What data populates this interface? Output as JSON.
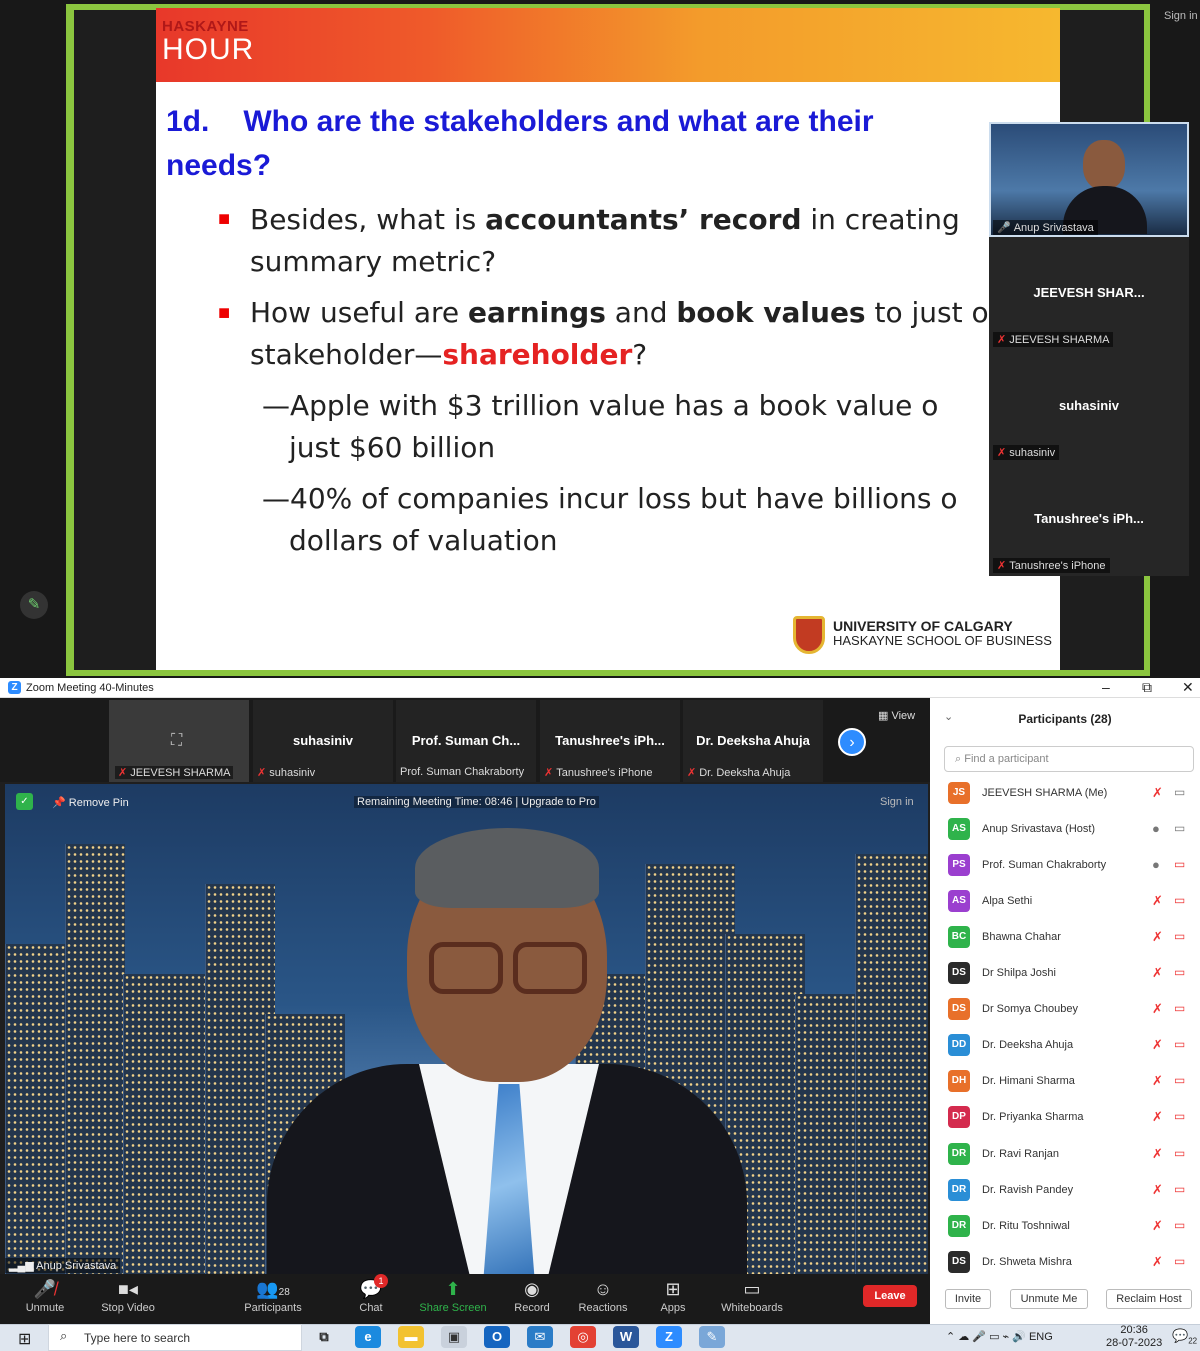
{
  "slide": {
    "brand": "HASKAYNE",
    "brand_sub": "HOUR",
    "title_num": "1d.",
    "title": "Who are the stakeholders and what are their needs?",
    "b1_pre": "Besides, what is ",
    "b1_bold": "accountants’ record",
    "b1_post": " in creating",
    "b1_line2": "summary metric?",
    "b2_pre": "How useful are ",
    "b2_bold1": "earnings",
    "b2_mid": " and ",
    "b2_bold2": "book values",
    "b2_post": " to just on",
    "b2_line2a": "stakeholder—",
    "b2_red": "shareholder",
    "b2_line2b": "?",
    "sub1_l1": "—Apple with $3 trillion value has a book value o",
    "sub1_l2": "just $60 billion",
    "sub2_l1": "—40% of companies incur loss but have billions o",
    "sub2_l2": "dollars of valuation",
    "logo_line1": "UNIVERSITY OF CALGARY",
    "logo_line2": "HASKAYNE SCHOOL OF BUSINESS"
  },
  "top_videos": [
    {
      "label": "Anup Srivastava"
    },
    {
      "name": "JEEVESH SHAR...",
      "label": "JEEVESH SHARMA"
    },
    {
      "name": "suhasiniv",
      "label": "suhasiniv"
    },
    {
      "name": "Tanushree's iPh...",
      "label": "Tanushree's iPhone"
    }
  ],
  "top_signin": "Sign in",
  "window": {
    "title": "Zoom Meeting 40-Minutes",
    "minimize": "–",
    "restore": "⧉",
    "close": "✕"
  },
  "thumbnails": [
    {
      "name": "",
      "label": "JEEVESH SHARMA"
    },
    {
      "name": "suhasiniv",
      "label": "suhasiniv"
    },
    {
      "name": "Prof. Suman Ch...",
      "label": "Prof. Suman Chakraborty"
    },
    {
      "name": "Tanushree's iPh...",
      "label": "Tanushree's iPhone"
    },
    {
      "name": "Dr. Deeksha Ahuja",
      "label": "Dr. Deeksha Ahuja"
    }
  ],
  "view_label": "View",
  "main_video": {
    "remove_pin": "Remove Pin",
    "remaining": "Remaining Meeting Time: 08:46 | Upgrade to Pro",
    "signin": "Sign in",
    "speaker": "Anup Srivastava"
  },
  "toolbar": {
    "unmute": "Unmute",
    "stop_video": "Stop Video",
    "participants": "Participants",
    "participants_count": "28",
    "chat": "Chat",
    "chat_badge": "1",
    "share_screen": "Share Screen",
    "record": "Record",
    "reactions": "Reactions",
    "apps": "Apps",
    "whiteboards": "Whiteboards",
    "leave": "Leave"
  },
  "participants_panel": {
    "title": "Participants (28)",
    "search_placeholder": "Find a participant",
    "invite": "Invite",
    "unmute_me": "Unmute Me",
    "reclaim_host": "Reclaim Host",
    "list": [
      {
        "initials": "JS",
        "name": "JEEVESH SHARMA (Me)",
        "color": "#e8702a"
      },
      {
        "initials": "AS",
        "name": "Anup Srivastava (Host)",
        "color": "#2fb34b"
      },
      {
        "initials": "PS",
        "name": "Prof. Suman Chakraborty",
        "color": "#9b3fcf"
      },
      {
        "initials": "AS",
        "name": "Alpa Sethi",
        "color": "#9b3fcf"
      },
      {
        "initials": "BC",
        "name": "Bhawna Chahar",
        "color": "#2fb34b"
      },
      {
        "initials": "DS",
        "name": "Dr Shilpa Joshi",
        "color": "#2b2b2b"
      },
      {
        "initials": "DS",
        "name": "Dr Somya Choubey",
        "color": "#e8702a"
      },
      {
        "initials": "DD",
        "name": "Dr. Deeksha Ahuja",
        "color": "#2a8ed6"
      },
      {
        "initials": "DH",
        "name": "Dr. Himani Sharma",
        "color": "#e8702a"
      },
      {
        "initials": "DP",
        "name": "Dr. Priyanka Sharma",
        "color": "#d42b4e"
      },
      {
        "initials": "DR",
        "name": "Dr. Ravi Ranjan",
        "color": "#2fb34b"
      },
      {
        "initials": "DR",
        "name": "Dr. Ravish Pandey",
        "color": "#2a8ed6"
      },
      {
        "initials": "DR",
        "name": "Dr. Ritu Toshniwal",
        "color": "#2fb34b"
      },
      {
        "initials": "DS",
        "name": "Dr. Shweta Mishra",
        "color": "#2b2b2b"
      }
    ]
  },
  "taskbar": {
    "search": "Type here to search",
    "lang": "ENG",
    "time": "20:36",
    "date": "28-07-2023",
    "notif": "22"
  }
}
